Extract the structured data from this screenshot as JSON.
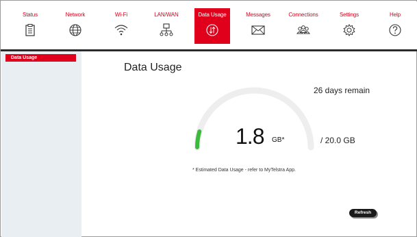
{
  "nav": [
    {
      "label": "Status",
      "icon": "status-icon"
    },
    {
      "label": "Network",
      "icon": "globe-icon"
    },
    {
      "label": "Wi-Fi",
      "icon": "wifi-icon"
    },
    {
      "label": "LAN/WAN",
      "icon": "lan-icon"
    },
    {
      "label": "Data Usage",
      "icon": "data-transfer-icon",
      "active": true
    },
    {
      "label": "Messages",
      "icon": "envelope-icon"
    },
    {
      "label": "Connections",
      "icon": "users-icon"
    },
    {
      "label": "Settings",
      "icon": "gear-icon"
    },
    {
      "label": "Help",
      "icon": "question-icon"
    }
  ],
  "sidebar": {
    "items": [
      {
        "label": "Data Usage"
      }
    ]
  },
  "main": {
    "title": "Data Usage",
    "days_remain": "26 days remain",
    "usage_value": "1.8",
    "usage_unit": "GB*",
    "total": "/ 20.0 GB",
    "usage_fraction": 0.09,
    "note": "* Estimated Data Usage - refer to MyTelstra App.",
    "refresh_label": "Refresh"
  },
  "colors": {
    "accent": "#e0001b",
    "gauge_fill": "#3dba3d",
    "gauge_track": "#eeeeee",
    "sidebar_bg": "#e8eef1"
  }
}
